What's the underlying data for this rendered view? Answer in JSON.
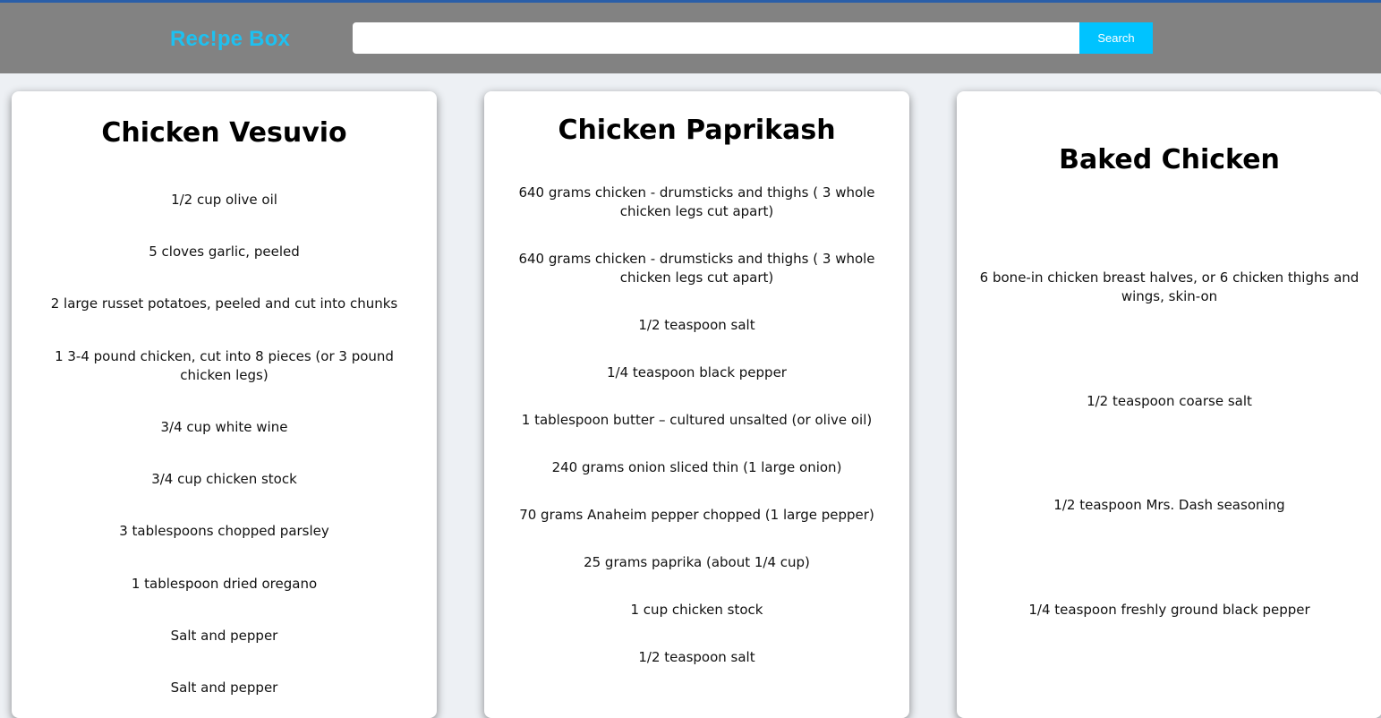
{
  "app": {
    "brand": "Rec!pe Box",
    "search": {
      "value": "",
      "placeholder": "",
      "button_label": "Search"
    },
    "colors": {
      "header_bg": "#828282",
      "brand": "#1ec0f0",
      "button": "#00c3ff",
      "page_bg": "#edf0f4"
    }
  },
  "recipes": [
    {
      "title": "Chicken Vesuvio",
      "ingredients": [
        "1/2 cup olive oil",
        "5 cloves garlic, peeled",
        "2 large russet potatoes, peeled and cut into chunks",
        "1 3-4 pound chicken, cut into 8 pieces (or 3 pound chicken legs)",
        "3/4 cup white wine",
        "3/4 cup chicken stock",
        "3 tablespoons chopped parsley",
        "1 tablespoon dried oregano",
        "Salt and pepper",
        "Salt and pepper"
      ]
    },
    {
      "title": "Chicken Paprikash",
      "ingredients": [
        "640 grams chicken - drumsticks and thighs ( 3 whole chicken legs cut apart)",
        "640 grams chicken - drumsticks and thighs ( 3 whole chicken legs cut apart)",
        "1/2 teaspoon salt",
        "1/4 teaspoon black pepper",
        "1 tablespoon butter – cultured unsalted (or olive oil)",
        "240 grams onion sliced thin (1 large onion)",
        "70 grams Anaheim pepper chopped (1 large pepper)",
        "25 grams paprika (about 1/4 cup)",
        "1 cup chicken stock",
        "1/2 teaspoon salt"
      ]
    },
    {
      "title": "Baked Chicken",
      "ingredients": [
        "6 bone-in chicken breast halves, or 6 chicken thighs and wings, skin-on",
        "1/2 teaspoon coarse salt",
        "1/2 teaspoon Mrs. Dash seasoning",
        "1/4 teaspoon freshly ground black pepper"
      ]
    }
  ]
}
